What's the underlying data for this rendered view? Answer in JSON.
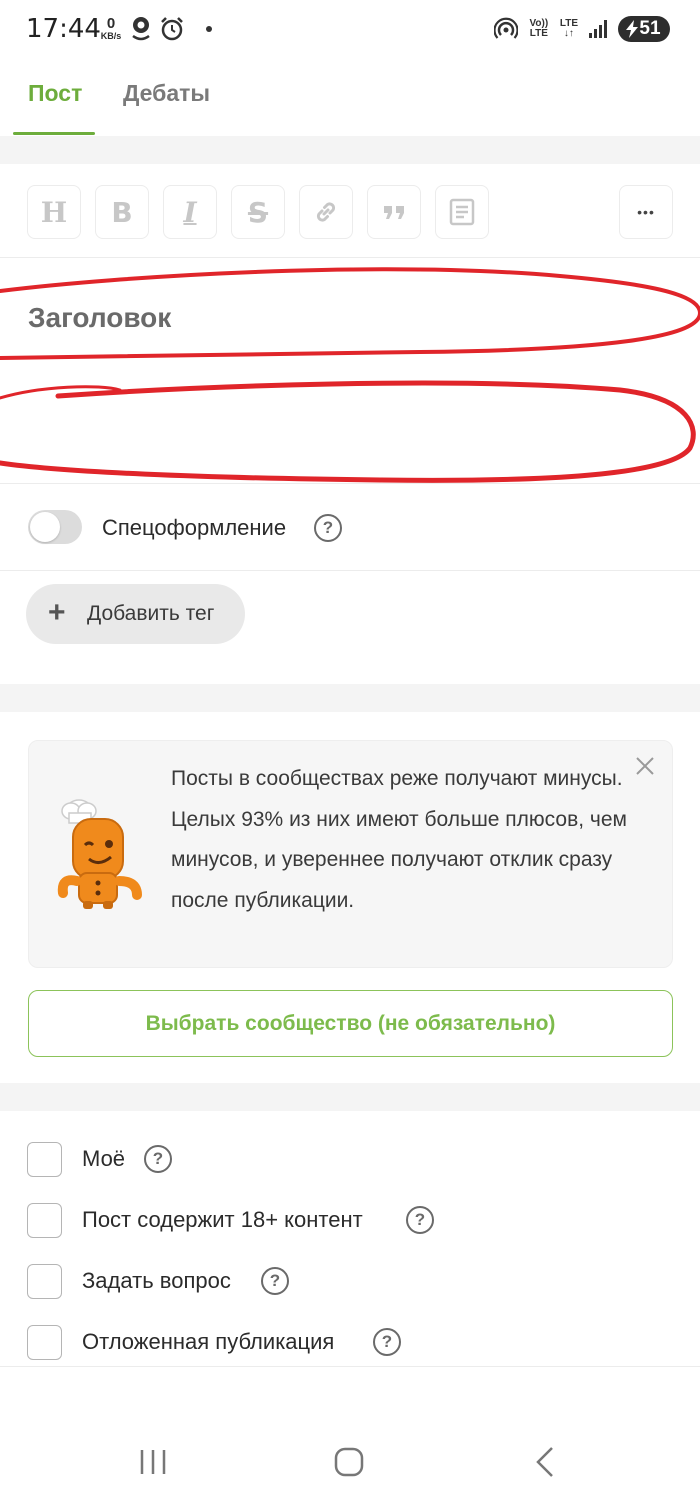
{
  "status_bar": {
    "time": "17:44",
    "speed_value": "0",
    "speed_unit": "KB/s",
    "volte": "Vo)) LTE",
    "lte": "LTE",
    "battery": "51"
  },
  "tabs": [
    {
      "label": "Пост",
      "active": true
    },
    {
      "label": "Дебаты",
      "active": false
    }
  ],
  "toolbar": {
    "heading_glyph": "H",
    "bold_glyph": "B",
    "italic_glyph": "I",
    "strike_glyph": "S",
    "more_label": "•••"
  },
  "editor": {
    "title_placeholder": "Заголовок"
  },
  "special_format": {
    "label": "Спецоформление",
    "enabled": false
  },
  "tags": {
    "add_label": "Добавить тег"
  },
  "community_info": {
    "text": "Посты в сообществах реже получают минусы. Целых 93% из них имеют больше плюсов, чем минусов, и увереннее получают отклик сразу после публикации."
  },
  "choose_community": {
    "label": "Выбрать сообщество (не обязательно)"
  },
  "options": [
    {
      "label": "Моё",
      "checked": false
    },
    {
      "label": "Пост содержит 18+ контент",
      "checked": false
    },
    {
      "label": "Задать вопрос",
      "checked": false
    },
    {
      "label": "Отложенная публикация",
      "checked": false
    }
  ],
  "colors": {
    "accent": "#6dad3c",
    "scribble": "#e0252a"
  }
}
